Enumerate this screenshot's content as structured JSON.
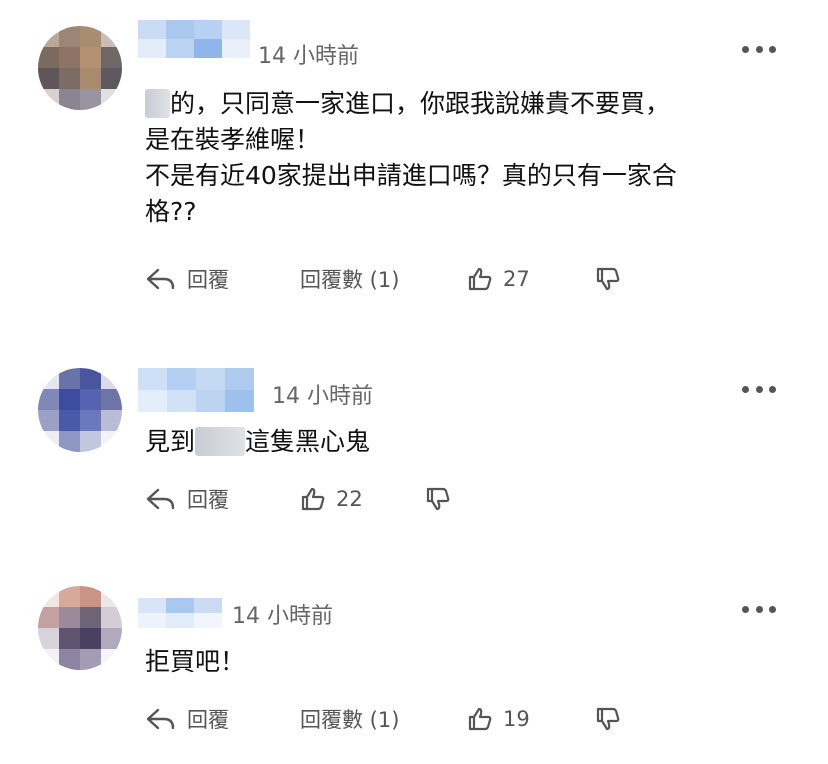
{
  "comments": [
    {
      "time": "14 小時前",
      "text_lead": "的，只同意一家進口，你跟我說嫌貴不要買，",
      "text_rest": "是在裝孝維喔！\n不是有近40家提出申請進口嗎？真的只有一家合\n格??",
      "reply_label": "回覆",
      "reply_count_label": "回覆數 (1)",
      "likes": "27"
    },
    {
      "time": "14 小時前",
      "text_a": "見到",
      "text_b": "這隻黑心鬼",
      "reply_label": "回覆",
      "likes": "22"
    },
    {
      "time": "14 小時前",
      "text": "拒買吧！",
      "reply_label": "回覆",
      "reply_count_label": "回覆數 (1)",
      "likes": "19"
    }
  ],
  "colors": {
    "text": "#111111",
    "meta": "#666666",
    "icon": "#555555"
  },
  "icons": [
    "reply-arrow-icon",
    "thumbs-up-icon",
    "thumbs-down-icon",
    "more-options-icon"
  ]
}
